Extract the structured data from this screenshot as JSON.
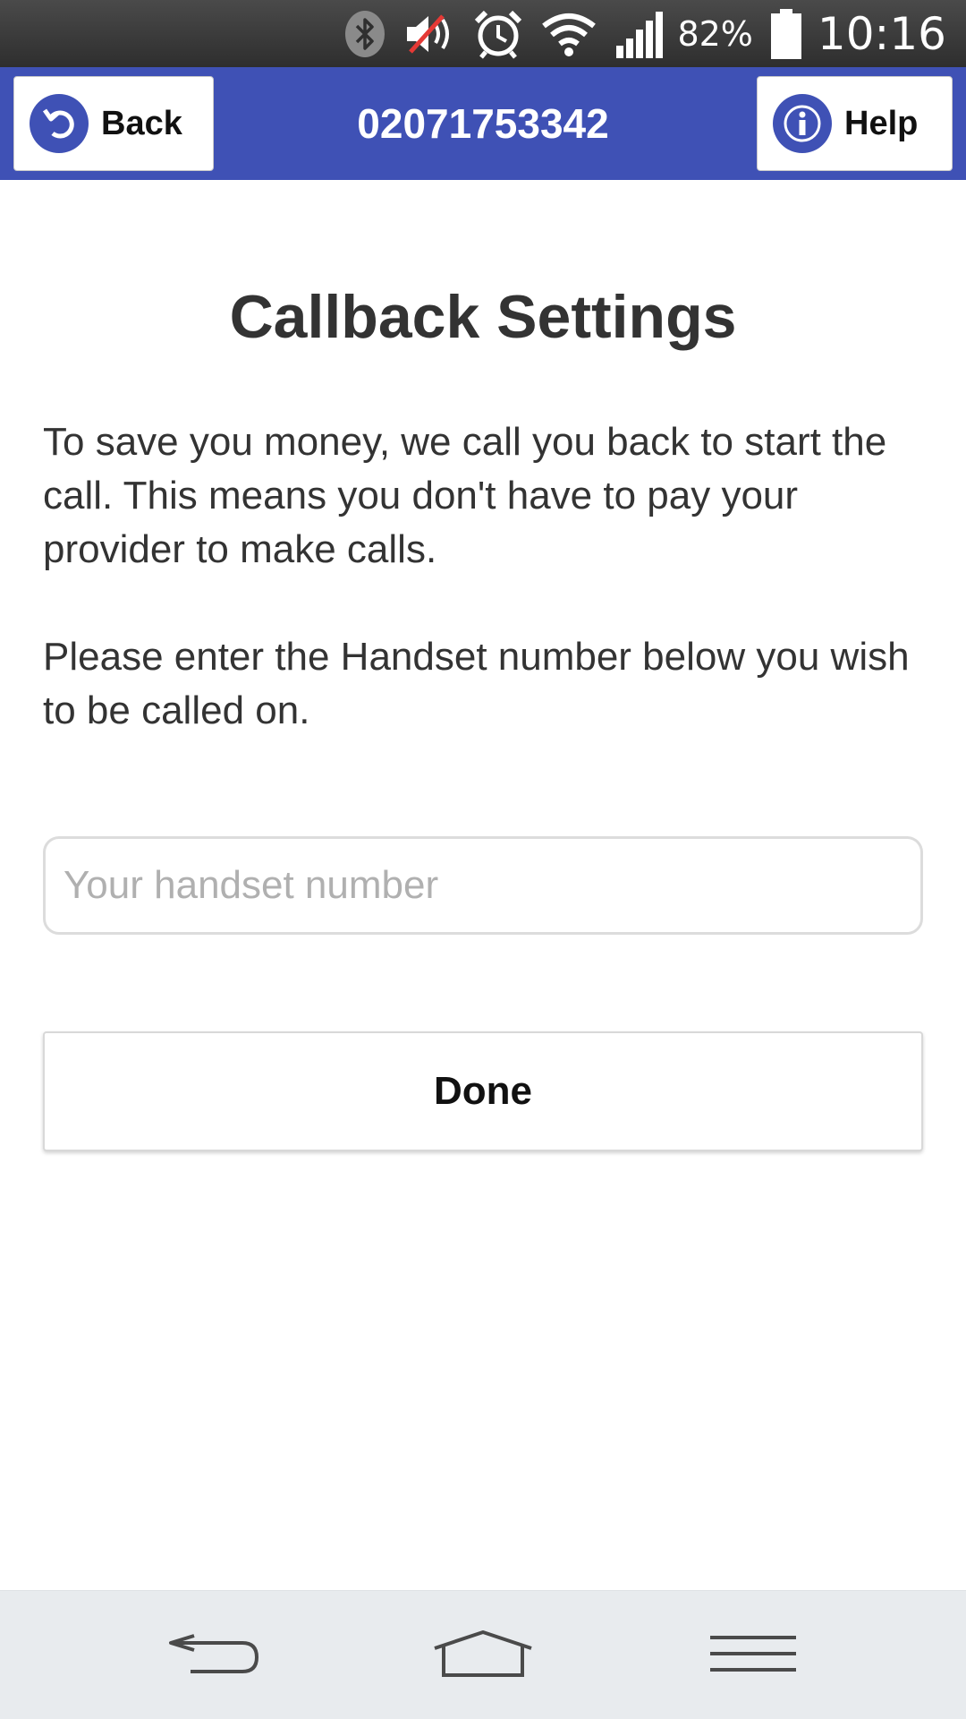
{
  "status_bar": {
    "battery_percent": "82%",
    "time": "10:16",
    "icons": [
      "bluetooth-icon",
      "volume-muted-icon",
      "alarm-icon",
      "wifi-icon",
      "signal-icon",
      "battery-icon"
    ]
  },
  "header": {
    "back_label": "Back",
    "title": "02071753342",
    "help_label": "Help",
    "background_color": "#3f51b5"
  },
  "main": {
    "title": "Callback Settings",
    "paragraph_1": "To save you money, we call you back to start the call. This means you don't have to pay your provider to make calls.",
    "paragraph_2": "Please enter the Handset number below you wish to be called on.",
    "handset_input": {
      "value": "",
      "placeholder": "Your handset number"
    },
    "done_label": "Done"
  },
  "nav_bar": {
    "icons": [
      "nav-back-icon",
      "nav-home-icon",
      "nav-menu-icon"
    ]
  }
}
